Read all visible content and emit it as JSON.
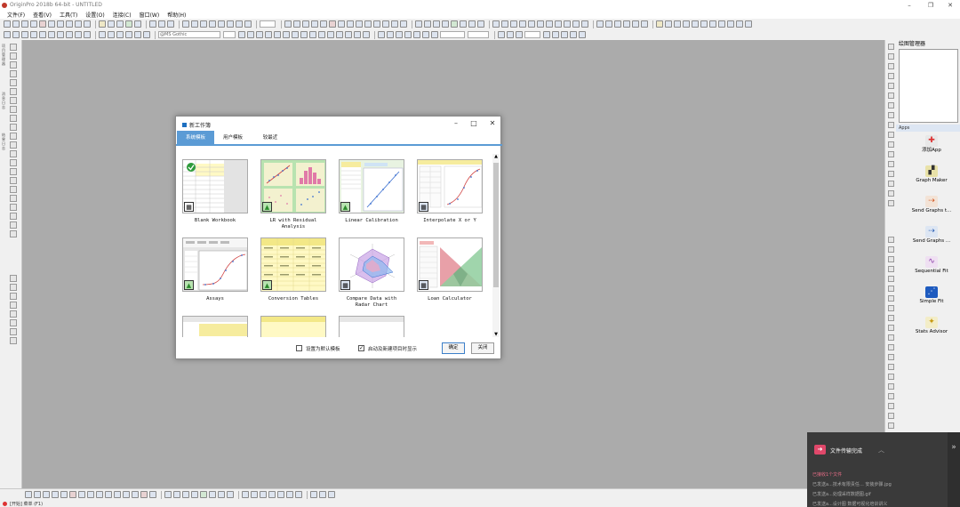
{
  "window": {
    "title": "OriginPro 2018b 64-bit - UNTITLED"
  },
  "menu": [
    "文件(F)",
    "查看(V)",
    "工具(T)",
    "设置(O)",
    "连接(C)",
    "窗口(W)",
    "帮助(H)"
  ],
  "toolbar": {
    "font_name": "@MS Gothic"
  },
  "left_panel": {
    "label_1": "项目管理器",
    "label_2": "消息日志",
    "label_3": "结果日志"
  },
  "object_manager": {
    "title": "绘图管理器"
  },
  "apps_panel": {
    "title": "Apps",
    "items": [
      {
        "label": "添加App",
        "icon": "add-app-icon"
      },
      {
        "label": "Graph Maker",
        "icon": "graph-maker-icon"
      },
      {
        "label": "Send Graphs t...",
        "icon": "send-graphs-ppt-icon"
      },
      {
        "label": "Send Graphs ...",
        "icon": "send-graphs-word-icon"
      },
      {
        "label": "Sequential Fit",
        "icon": "sequential-fit-icon"
      },
      {
        "label": "Simple Fit",
        "icon": "simple-fit-icon"
      },
      {
        "label": "Stats Advisor",
        "icon": "stats-advisor-icon"
      }
    ]
  },
  "dialog": {
    "title": "新工作簿",
    "tabs": [
      "系统模板",
      "用户模板",
      "较最近"
    ],
    "templates": [
      {
        "name": "Blank Workbook"
      },
      {
        "name": "LR with Residual Analysis"
      },
      {
        "name": "Linear Calibration"
      },
      {
        "name": "Interpolate X or Y"
      },
      {
        "name": "Assays"
      },
      {
        "name": "Conversion Tables"
      },
      {
        "name": "Compare Data with Radar Chart"
      },
      {
        "name": "Loan Calculator"
      }
    ],
    "set_default_label": "设置为默认模板",
    "show_on_start_label": "启动及新建项目时显示",
    "ok_label": "确定",
    "close_label": "关闭"
  },
  "status": {
    "text": "[开始] 菜单 (F1)"
  },
  "toast": {
    "title": "文件传输完成",
    "lines": [
      "已接收1个文件",
      "已发送a...技术有限责任… 安装步骤.jpg",
      "已发送a...处理采样数据图.gif",
      "已发送a...设计图 数据可视化培训讲义"
    ]
  },
  "colors": {
    "accent": "#5b9bd5",
    "workspace": "#ababab",
    "toast_bg": "#3a3a3a"
  }
}
